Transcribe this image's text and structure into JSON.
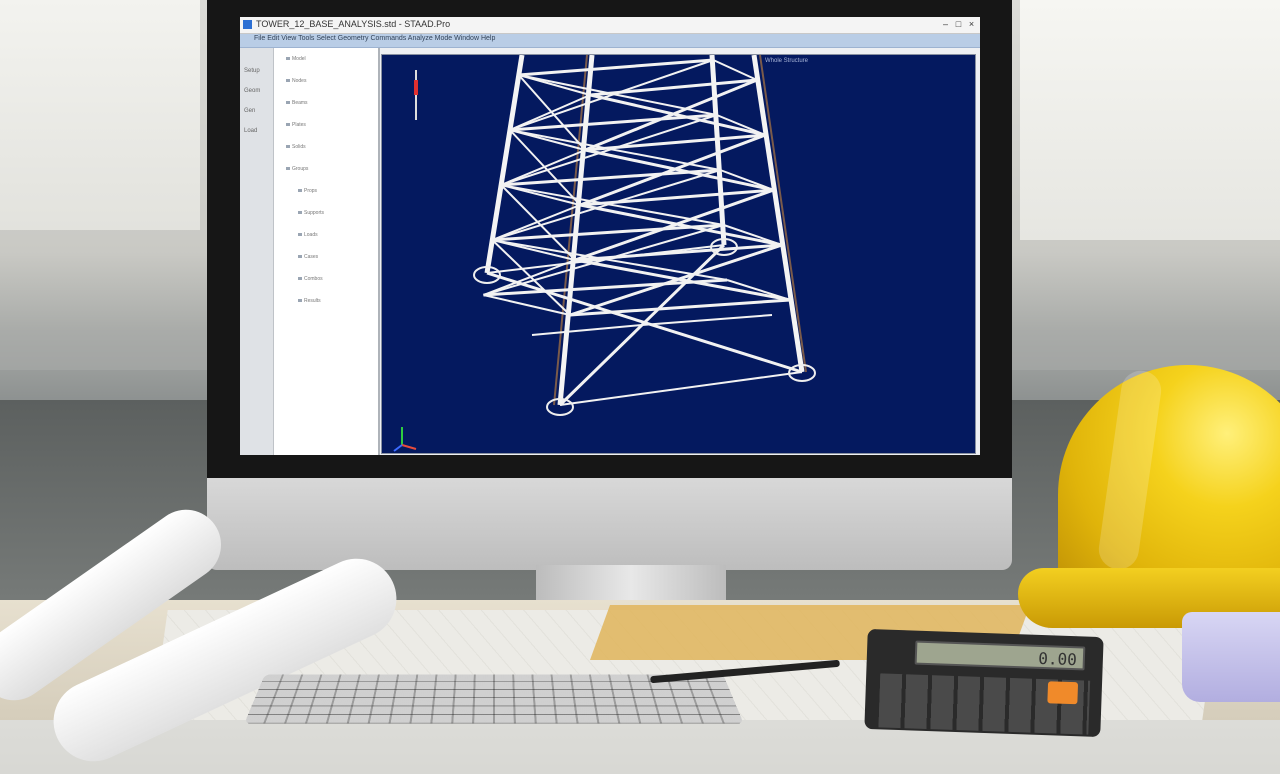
{
  "app": {
    "title": "TOWER_12_BASE_ANALYSIS.std - STAAD.Pro",
    "window_controls": [
      "–",
      "□",
      "×"
    ],
    "menu": "File  Edit  View  Tools  Select  Geometry  Commands  Analyze  Mode  Window  Help"
  },
  "left_strip": {
    "labels": [
      "Setup",
      "Geom",
      "Gen",
      "Load"
    ]
  },
  "tree": {
    "items": [
      "Model",
      "Nodes",
      "Beams",
      "Plates",
      "Solids",
      "Groups",
      "Props",
      "Supports",
      "Loads",
      "Cases",
      "Combos",
      "Results"
    ]
  },
  "viewport": {
    "status_text": "Whole Structure",
    "background_color": "#04195f",
    "axis_icon": "xyz-axis-icon",
    "scale_icon": "scale-bar-icon"
  },
  "calculator": {
    "display": "0.00"
  },
  "colors": {
    "helmet": "#f5d21c",
    "toolbar": "#b9cde6",
    "member": "#f2f2f2"
  }
}
